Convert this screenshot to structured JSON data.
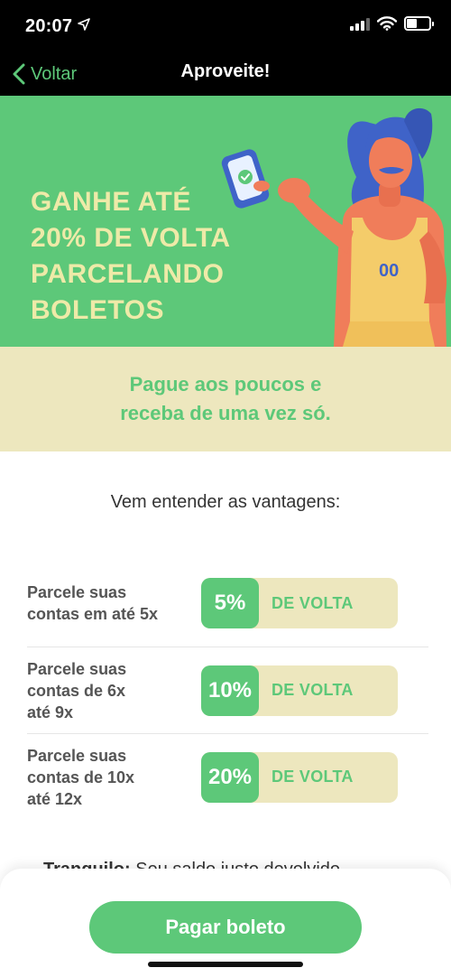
{
  "status_bar": {
    "time": "20:07"
  },
  "nav": {
    "back_label": "Voltar",
    "title": "Aproveite!"
  },
  "hero": {
    "headline_lines": [
      "GANHE ATÉ",
      "20% DE VOLTA",
      "PARCELANDO",
      "BOLETOS"
    ],
    "jersey_number": "00"
  },
  "tagline": {
    "lines": [
      "Pague aos poucos e",
      "receba de uma vez só."
    ]
  },
  "section_title": "Vem entender as vantagens:",
  "benefits": [
    {
      "label_lines": [
        "Parcele suas",
        "contas em até 5x"
      ],
      "percent": "5%",
      "suffix": "DE VOLTA"
    },
    {
      "label_lines": [
        "Parcele suas",
        "contas de 6x",
        "até 9x"
      ],
      "percent": "10%",
      "suffix": "DE VOLTA"
    },
    {
      "label_lines": [
        "Parcele suas",
        "contas de 10x",
        "até 12x"
      ],
      "percent": "20%",
      "suffix": "DE VOLTA"
    }
  ],
  "partial_text": {
    "bold": "Tranquilo:",
    "rest": " Seu saldo justo devolvido"
  },
  "bottom": {
    "pay_button_label": "Pagar boleto"
  },
  "colors": {
    "green": "#5dc879",
    "cream": "#ede7be",
    "headline": "#eeeaa8"
  },
  "icons": [
    "location-arrow-icon",
    "signal-icon",
    "wifi-icon",
    "battery-icon",
    "chevron-left-icon",
    "check-icon"
  ]
}
